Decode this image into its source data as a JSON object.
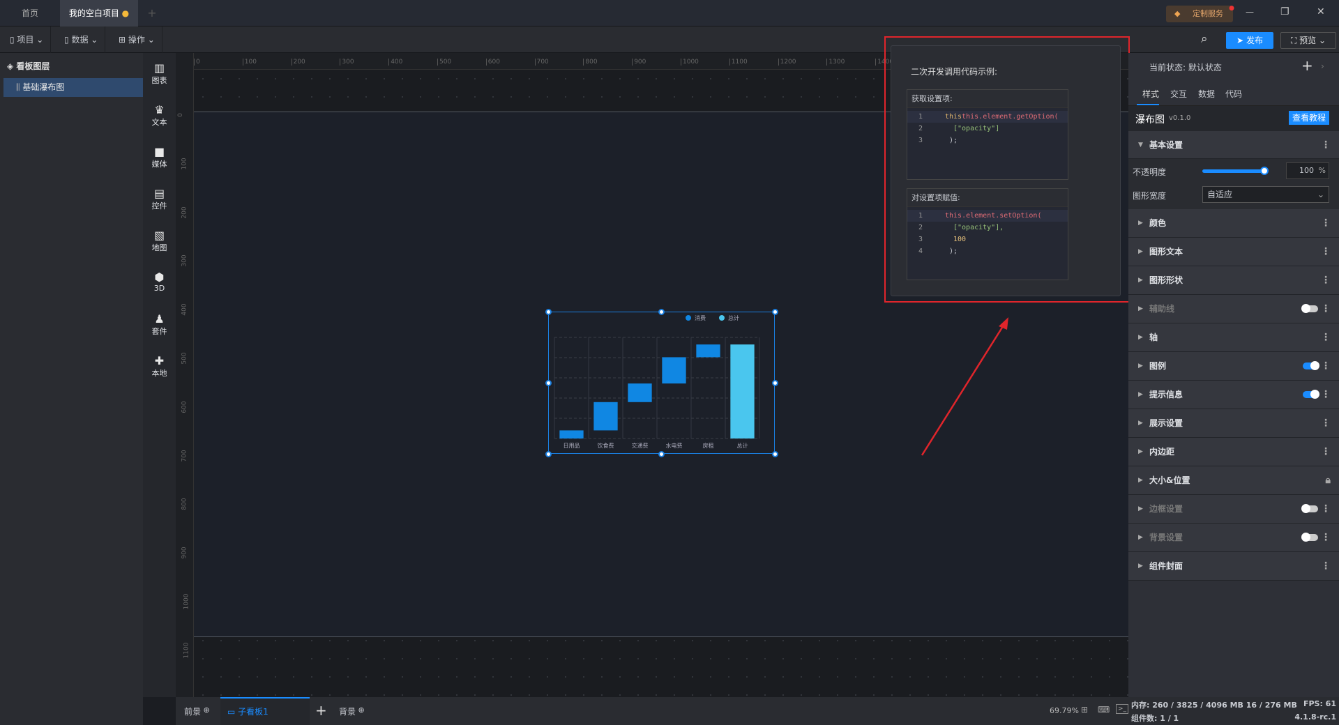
{
  "titlebar": {
    "tabs": [
      {
        "label": "首页"
      },
      {
        "label": "我的空白项目",
        "modified": true
      }
    ],
    "add_tab": "+",
    "custom_service": "定制服务",
    "minimize": "—",
    "restore": "❐",
    "close": "✕"
  },
  "toolbar": {
    "menus": [
      {
        "label": "项目",
        "icon": "file-icon"
      },
      {
        "label": "数据",
        "icon": "database-icon"
      },
      {
        "label": "操作",
        "icon": "grid-icon"
      }
    ],
    "publish": "发布",
    "preview": "预览"
  },
  "layers": {
    "title": "看板图层",
    "items": [
      {
        "label": "基础瀑布图"
      }
    ]
  },
  "components": [
    {
      "label": "图表",
      "glyph": "▥"
    },
    {
      "label": "文本",
      "glyph": "♛"
    },
    {
      "label": "媒体",
      "glyph": "■"
    },
    {
      "label": "控件",
      "glyph": "▤"
    },
    {
      "label": "地图",
      "glyph": "▧"
    },
    {
      "label": "3D",
      "glyph": "⬢"
    },
    {
      "label": "套件",
      "glyph": "♟"
    },
    {
      "label": "本地",
      "glyph": "✚"
    }
  ],
  "ruler": {
    "h": [
      "0",
      "100",
      "200",
      "300",
      "400",
      "500",
      "600",
      "700",
      "800",
      "900",
      "1000",
      "1100",
      "1200",
      "1300",
      "1400"
    ],
    "v": [
      "0",
      "100",
      "200",
      "300",
      "400",
      "500",
      "600",
      "700",
      "800",
      "900",
      "1000",
      "1100"
    ]
  },
  "chart_data": {
    "type": "bar",
    "subtype": "waterfall",
    "categories": [
      "日用品",
      "饮食费",
      "交通费",
      "水电费",
      "房租",
      "总计"
    ],
    "series": [
      {
        "name": "消费",
        "color": "#1087e3",
        "values": [
          400,
          1400,
          920,
          1300,
          630,
          null
        ]
      },
      {
        "name": "总计",
        "color": "#4ac6ee",
        "values": [
          null,
          null,
          null,
          null,
          null,
          4650
        ]
      }
    ],
    "ylim": [
      0,
      5000
    ],
    "grid": true,
    "legend": "top-right"
  },
  "popup": {
    "title": "二次开发调用代码示例:",
    "get": {
      "title": "获取设置项:",
      "lines": [
        "this.element.getOption(",
        "[\"opacity\"]",
        ");"
      ]
    },
    "set": {
      "title": "对设置项赋值:",
      "lines": [
        "this.element.setOption(",
        "[\"opacity\"],",
        "100",
        ");"
      ]
    }
  },
  "panel": {
    "state_label": "当前状态:",
    "state_value": "默认状态",
    "tabs": [
      "样式",
      "交互",
      "数据",
      "代码"
    ],
    "component_name": "瀑布图",
    "version": "v0.1.0",
    "tutorial": "查看教程",
    "basic": "基本设置",
    "opacity_label": "不透明度",
    "opacity_value": "100",
    "opacity_unit": "%",
    "opacity": 100,
    "width_label": "图形宽度",
    "width_value": "自适应",
    "sections": [
      {
        "label": "颜色"
      },
      {
        "label": "图形文本"
      },
      {
        "label": "图形形状"
      },
      {
        "label": "辅助线",
        "toggle": false,
        "dim": true
      },
      {
        "label": "轴"
      },
      {
        "label": "图例",
        "toggle": true
      },
      {
        "label": "提示信息",
        "toggle": true
      },
      {
        "label": "展示设置"
      },
      {
        "label": "内边距"
      },
      {
        "label": "大小&位置",
        "lock": true
      },
      {
        "label": "边框设置",
        "toggle": false,
        "dim": true
      },
      {
        "label": "背景设置",
        "toggle": false,
        "dim": true
      },
      {
        "label": "组件封面"
      }
    ]
  },
  "bottom": {
    "foreground": "前景",
    "sub_board": "子看板1",
    "add": "+",
    "background": "背景",
    "zoom": "69.79%"
  },
  "status": {
    "memory": "内存: 260 / 3825 / 4096 MB  16 / 276 MB",
    "fps": "FPS:  61",
    "count": "组件数: 1 / 1",
    "version": "4.1.8-rc.1"
  },
  "colors": {
    "accent": "#1a8cff",
    "highlight": "#e0252b"
  }
}
